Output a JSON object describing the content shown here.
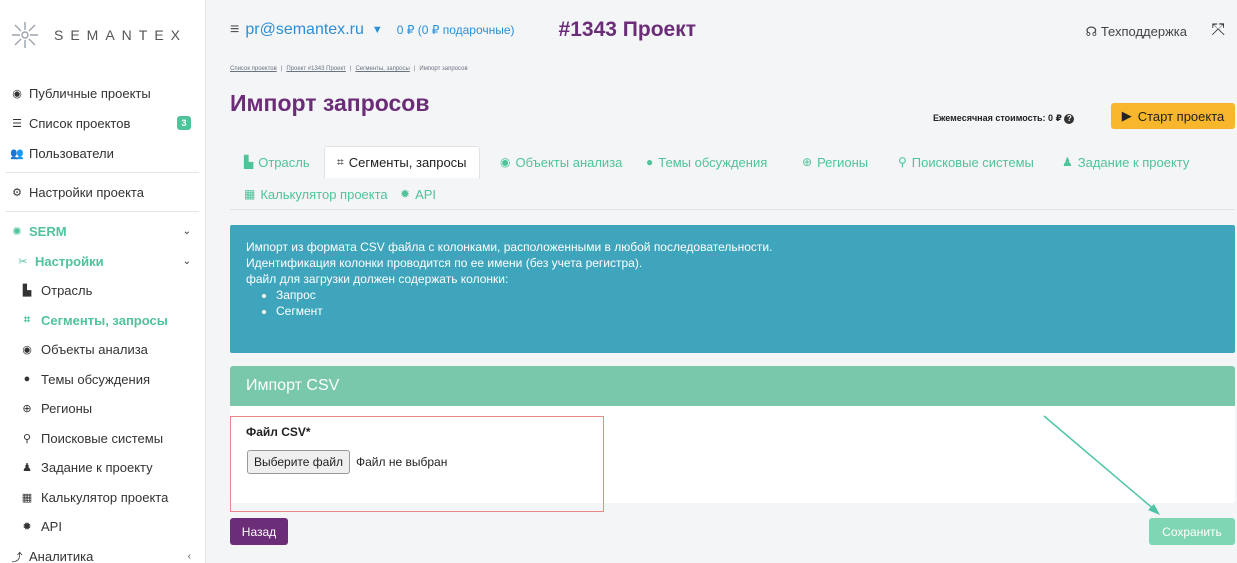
{
  "logo": {
    "text": "SEMANTEX"
  },
  "sidebar": {
    "items": [
      {
        "icon": "eye-icon",
        "glyph": "◉",
        "label": "Публичные проекты"
      },
      {
        "icon": "list-icon",
        "glyph": "☰",
        "label": "Список проектов",
        "badge": "3"
      },
      {
        "icon": "users-icon",
        "glyph": "👥",
        "label": "Пользователи"
      },
      {
        "icon": "gears-icon",
        "glyph": "⚙",
        "label": "Настройки проекта"
      }
    ],
    "serm": {
      "label": "SERM",
      "glyph": "✺"
    },
    "settings": {
      "label": "Настройки",
      "glyph": "✂"
    },
    "sub_items": [
      {
        "icon": "industry-icon",
        "glyph": "▙",
        "label": "Отрасль"
      },
      {
        "icon": "segments-icon",
        "glyph": "⌗",
        "label": "Сегменты, запросы"
      },
      {
        "icon": "target-icon",
        "glyph": "◉",
        "label": "Объекты анализа"
      },
      {
        "icon": "comments-icon",
        "glyph": "●",
        "label": "Темы обсуждения"
      },
      {
        "icon": "globe-icon",
        "glyph": "⊕",
        "label": "Регионы"
      },
      {
        "icon": "search-icon",
        "glyph": "⚲",
        "label": "Поисковые системы"
      },
      {
        "icon": "user-edit-icon",
        "glyph": "♟",
        "label": "Задание к проекту"
      },
      {
        "icon": "calculator-icon",
        "glyph": "▦",
        "label": "Калькулятор проекта"
      },
      {
        "icon": "cog-icon",
        "glyph": "✹",
        "label": "API"
      }
    ],
    "analytics": {
      "label": "Аналитика",
      "glyph": "⤴"
    }
  },
  "header": {
    "menu_glyph": "≡",
    "email": "pr@semantex.ru",
    "balance": "0 ₽ (0 ₽ подарочные)",
    "project": "#1343 Проект",
    "support": "Техподдержка",
    "support_glyph": "☊",
    "expand_glyph": "⤧"
  },
  "breadcrumb": [
    "Список проектов",
    "Проект #1343 Проект",
    "Сегменты, запросы",
    "Импорт запросов"
  ],
  "page": {
    "title": "Импорт запросов",
    "monthly_cost": "Ежемесячная стоимость: 0 ₽",
    "start_button": "Старт проекта"
  },
  "tabs": [
    {
      "glyph": "▙",
      "label": "Отрасль"
    },
    {
      "glyph": "⌗",
      "label": "Сегменты, запросы"
    },
    {
      "glyph": "◉",
      "label": "Объекты анализа"
    },
    {
      "glyph": "●",
      "label": "Темы обсуждения"
    },
    {
      "glyph": "⊕",
      "label": "Регионы"
    },
    {
      "glyph": "⚲",
      "label": "Поисковые системы"
    },
    {
      "glyph": "♟",
      "label": "Задание к проекту"
    },
    {
      "glyph": "▦",
      "label": "Калькулятор проекта"
    },
    {
      "glyph": "✹",
      "label": "API"
    }
  ],
  "info": {
    "line1": "Импорт из формата CSV файла с колонками, расположенными в любой последовательности.",
    "line2": "Идентификация колонки проводится по ее имени (без учета регистра).",
    "line3": "файл для загрузки должен содержать колонки:",
    "columns": [
      "Запрос",
      "Сегмент"
    ]
  },
  "import": {
    "title": "Импорт CSV",
    "field_label": "Файл CSV*",
    "choose_button": "Выберите файл",
    "no_file": "Файл не выбран"
  },
  "footer": {
    "back": "Назад",
    "save": "Сохранить"
  },
  "colors": {
    "brand_purple": "#6b2d77",
    "accent_green": "#4fc39a",
    "info_blue": "#3fa5bd",
    "start_orange": "#f7b62c"
  }
}
